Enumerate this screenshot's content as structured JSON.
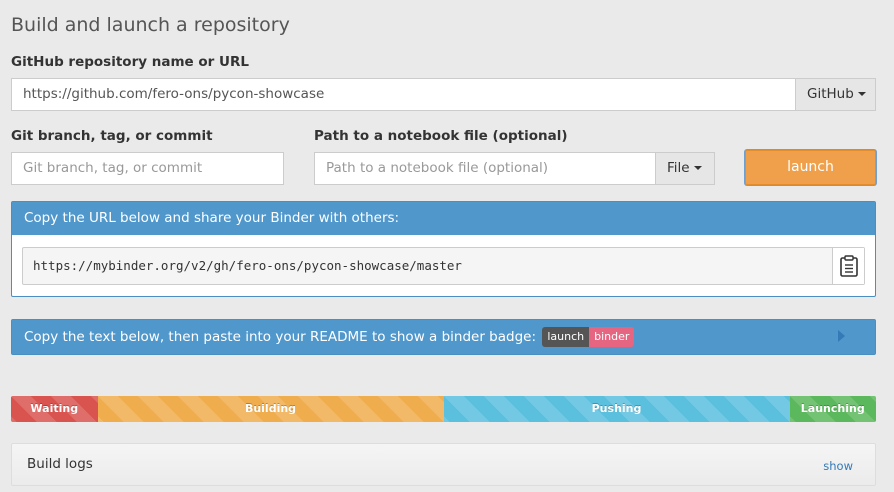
{
  "header": {
    "title": "Build and launch a repository"
  },
  "repo": {
    "label": "GitHub repository name or URL",
    "value": "https://github.com/fero-ons/pycon-showcase",
    "provider_label": "GitHub"
  },
  "ref": {
    "label": "Git branch, tag, or commit",
    "placeholder": "Git branch, tag, or commit"
  },
  "filepath": {
    "label": "Path to a notebook file (optional)",
    "placeholder": "Path to a notebook file (optional)",
    "type_label": "File"
  },
  "launch": {
    "label": "launch",
    "color": "#f0a04a"
  },
  "share": {
    "heading": "Copy the URL below and share your Binder with others:",
    "url": "https://mybinder.org/v2/gh/fero-ons/pycon-showcase/master",
    "copy_icon": "clipboard-icon"
  },
  "badge": {
    "heading": "Copy the text below, then paste into your README to show a binder badge:",
    "left": "launch",
    "right": "binder",
    "expand_icon": "play-icon"
  },
  "progress": {
    "segments": [
      {
        "label": "Waiting",
        "percent": 10,
        "color": "#d9534f"
      },
      {
        "label": "Building",
        "percent": 40,
        "color": "#f0ad4e"
      },
      {
        "label": "Pushing",
        "percent": 40,
        "color": "#5bc0de"
      },
      {
        "label": "Launching",
        "percent": 10,
        "color": "#5cb85c"
      }
    ]
  },
  "logs": {
    "title": "Build logs",
    "toggle": "show"
  }
}
